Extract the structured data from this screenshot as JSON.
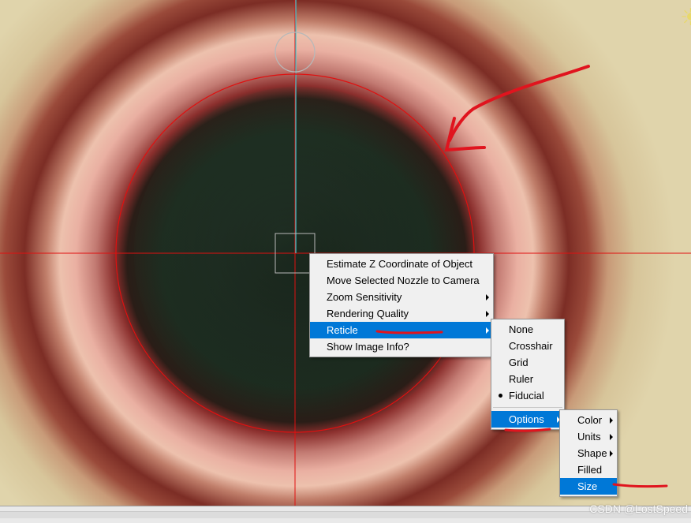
{
  "viewport": {
    "reticle_color": "#e01010",
    "crosshair_color": "#e01010",
    "vertical_line_color": "#37d0d6",
    "overlay_box_color": "#b8b8b8",
    "icons": [
      "sun-icon"
    ]
  },
  "context_menu": {
    "items": [
      {
        "label": "Estimate Z Coordinate of Object"
      },
      {
        "label": "Move Selected Nozzle to Camera"
      },
      {
        "label": "Zoom Sensitivity"
      },
      {
        "label": "Rendering Quality"
      },
      {
        "label": "Reticle"
      },
      {
        "label": "Show Image Info?"
      }
    ]
  },
  "reticle_menu": {
    "items": [
      {
        "label": "None"
      },
      {
        "label": "Crosshair"
      },
      {
        "label": "Grid"
      },
      {
        "label": "Ruler"
      },
      {
        "label": "Fiducial"
      }
    ],
    "options_label": "Options"
  },
  "options_menu": {
    "items": [
      {
        "label": "Color"
      },
      {
        "label": "Units"
      },
      {
        "label": "Shape"
      },
      {
        "label": "Filled"
      },
      {
        "label": "Size"
      }
    ]
  },
  "annotation_color": "#e0141e",
  "watermark": "CSDN @LostSpeed"
}
